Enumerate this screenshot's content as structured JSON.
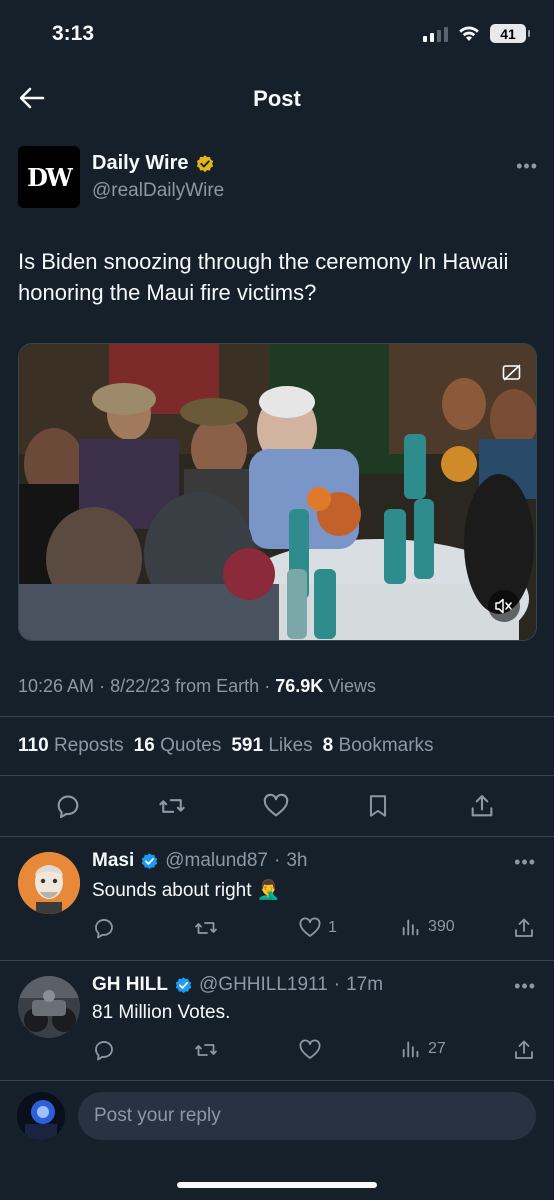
{
  "status": {
    "time": "3:13",
    "battery": "41"
  },
  "header": {
    "title": "Post"
  },
  "post": {
    "author_name": "Daily Wire",
    "author_handle": "@realDailyWire",
    "logo_text": "DW",
    "text": "Is Biden snoozing through the ceremony In Hawaii honoring the Maui fire victims?",
    "time": "10:26 AM",
    "date": "8/22/23",
    "source": "from Earth",
    "views_count": "76.9K",
    "views_label": "Views",
    "reposts_count": "110",
    "reposts_label": "Reposts",
    "quotes_count": "16",
    "quotes_label": "Quotes",
    "likes_count": "591",
    "likes_label": "Likes",
    "bookmarks_count": "8",
    "bookmarks_label": "Bookmarks"
  },
  "replies": [
    {
      "name": "Masi",
      "handle": "@malund87",
      "age": "3h",
      "text": "Sounds about right 🤦‍♂️",
      "likes": "1",
      "views": "390"
    },
    {
      "name": "GH HILL",
      "handle": "@GHHILL1911",
      "age": "17m",
      "text": "81 Million Votes.",
      "likes": "",
      "views": "27"
    }
  ],
  "composer": {
    "placeholder": "Post your reply"
  },
  "colors": {
    "background": "#15202b",
    "verified_gold": "#e2b719",
    "verified_blue": "#1d9bf0",
    "muted": "#8b98a5"
  }
}
